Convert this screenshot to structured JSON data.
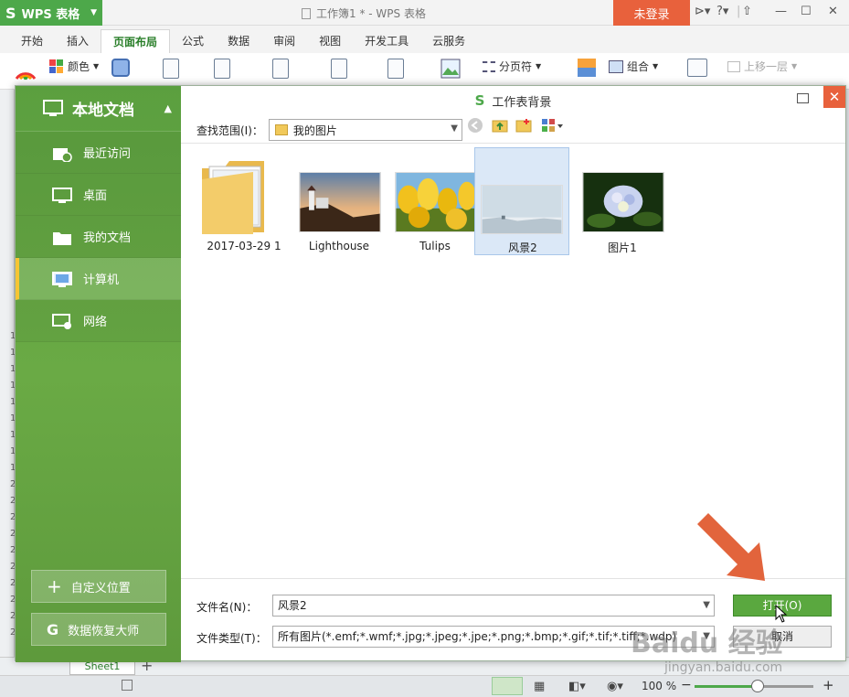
{
  "app": {
    "name": "WPS 表格",
    "document_title": "工作簿1 * - WPS 表格",
    "login_label": "未登录"
  },
  "ribbon": {
    "tabs": [
      {
        "label": "开始",
        "active": false
      },
      {
        "label": "插入",
        "active": false
      },
      {
        "label": "页面布局",
        "active": true
      },
      {
        "label": "公式",
        "active": false
      },
      {
        "label": "数据",
        "active": false
      },
      {
        "label": "审阅",
        "active": false
      },
      {
        "label": "视图",
        "active": false
      },
      {
        "label": "开发工具",
        "active": false
      },
      {
        "label": "云服务",
        "active": false
      }
    ],
    "color_label": "颜色",
    "page_break_label": "分页符",
    "group_label": "组合",
    "bring_forward_label": "上移一层"
  },
  "dialog": {
    "title": "工作表背景",
    "sidebar": {
      "header": "本地文档",
      "items": [
        {
          "label": "最近访问",
          "icon": "recent-folder-icon",
          "selected": false
        },
        {
          "label": "桌面",
          "icon": "desktop-icon",
          "selected": false
        },
        {
          "label": "我的文档",
          "icon": "folder-icon",
          "selected": false
        },
        {
          "label": "计算机",
          "icon": "computer-icon",
          "selected": true
        },
        {
          "label": "网络",
          "icon": "network-icon",
          "selected": false
        }
      ],
      "custom_location_label": "自定义位置",
      "recovery_label": "数据恢复大师"
    },
    "look_in_label": "查找范围(I)：",
    "look_in_value": "我的图片",
    "files": [
      {
        "name": "2017-03-29 1",
        "type": "folder",
        "selected": false
      },
      {
        "name": "Lighthouse",
        "type": "image",
        "selected": false
      },
      {
        "name": "Tulips",
        "type": "image",
        "selected": false
      },
      {
        "name": "风景2",
        "type": "image",
        "selected": true
      },
      {
        "name": "图片1",
        "type": "image",
        "selected": false
      }
    ],
    "filename_label": "文件名(N)：",
    "filename_value": "风景2",
    "filetype_label": "文件类型(T)：",
    "filetype_value": "所有图片(*.emf;*.wmf;*.jpg;*.jpeg;*.jpe;*.png;*.bmp;*.gif;*.tif;*.tiff;*.wdp)",
    "open_label": "打开(O)",
    "cancel_label": "取消"
  },
  "sheet": {
    "tab_label": "Sheet1"
  },
  "status": {
    "zoom_label": "100 %",
    "zoom_level": 0.55
  },
  "watermark": {
    "text": "Baidu 经验",
    "url": "jingyan.baidu.com"
  },
  "colors": {
    "brand_green": "#4da84a",
    "accent_orange": "#e8613c",
    "sidebar_green": "#65a843"
  }
}
